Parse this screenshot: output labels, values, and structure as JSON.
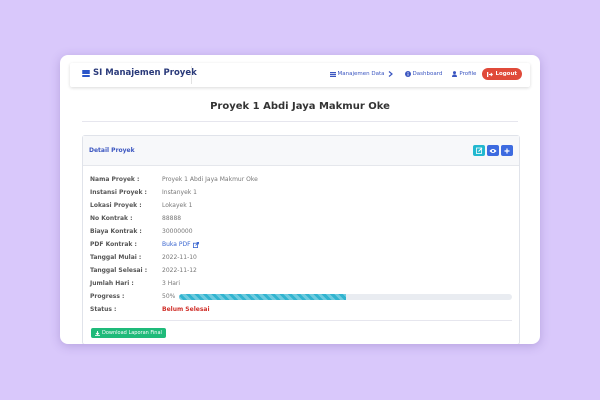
{
  "navbar": {
    "brand": "SI Manajemen Proyek",
    "menu": [
      {
        "label": "Manajemen Data",
        "icon": "table-icon",
        "has_chevron": true
      },
      {
        "label": "Dashboard",
        "icon": "info-icon"
      },
      {
        "label": "Profile",
        "icon": "user-icon"
      }
    ],
    "logout": "Logout"
  },
  "page": {
    "title": "Proyek 1 Abdi Jaya Makmur Oke"
  },
  "card": {
    "title": "Detail Proyek",
    "actions": [
      {
        "name": "edit-button",
        "icon": "edit-icon",
        "color": "#22b8cf"
      },
      {
        "name": "view-button",
        "icon": "eye-icon",
        "color": "#3d6be0"
      },
      {
        "name": "add-button",
        "icon": "plus-icon",
        "color": "#3d6be0"
      }
    ]
  },
  "details": {
    "nama_label": "Nama Proyek :",
    "nama": "Proyek 1 Abdi Jaya Makmur Oke",
    "instansi_label": "Instansi Proyek :",
    "instansi": "Instanyek 1",
    "lokasi_label": "Lokasi Proyek :",
    "lokasi": "Lokayek 1",
    "kontrak_label": "No Kontrak :",
    "kontrak": "88888",
    "biaya_label": "Biaya Kontrak :",
    "biaya": "30000000",
    "pdf_label": "PDF Kontrak :",
    "pdf_link": "Buka PDF",
    "mulai_label": "Tanggal Mulai :",
    "mulai": "2022-11-10",
    "selesai_label": "Tanggal Selesai :",
    "selesai": "2022-11-12",
    "hari_label": "Jumlah Hari :",
    "hari": "3 Hari",
    "progress_label": "Progress :",
    "progress_text": "50%",
    "progress_value": 0.5,
    "status_label": "Status :",
    "status": "Belum Selesai"
  },
  "download_button": "Download Laporan Final",
  "colors": {
    "background": "#d9c8fb",
    "primary": "#3a55c0",
    "danger": "#d0302a",
    "success": "#1fba7a",
    "progress": "#31b4d0"
  }
}
